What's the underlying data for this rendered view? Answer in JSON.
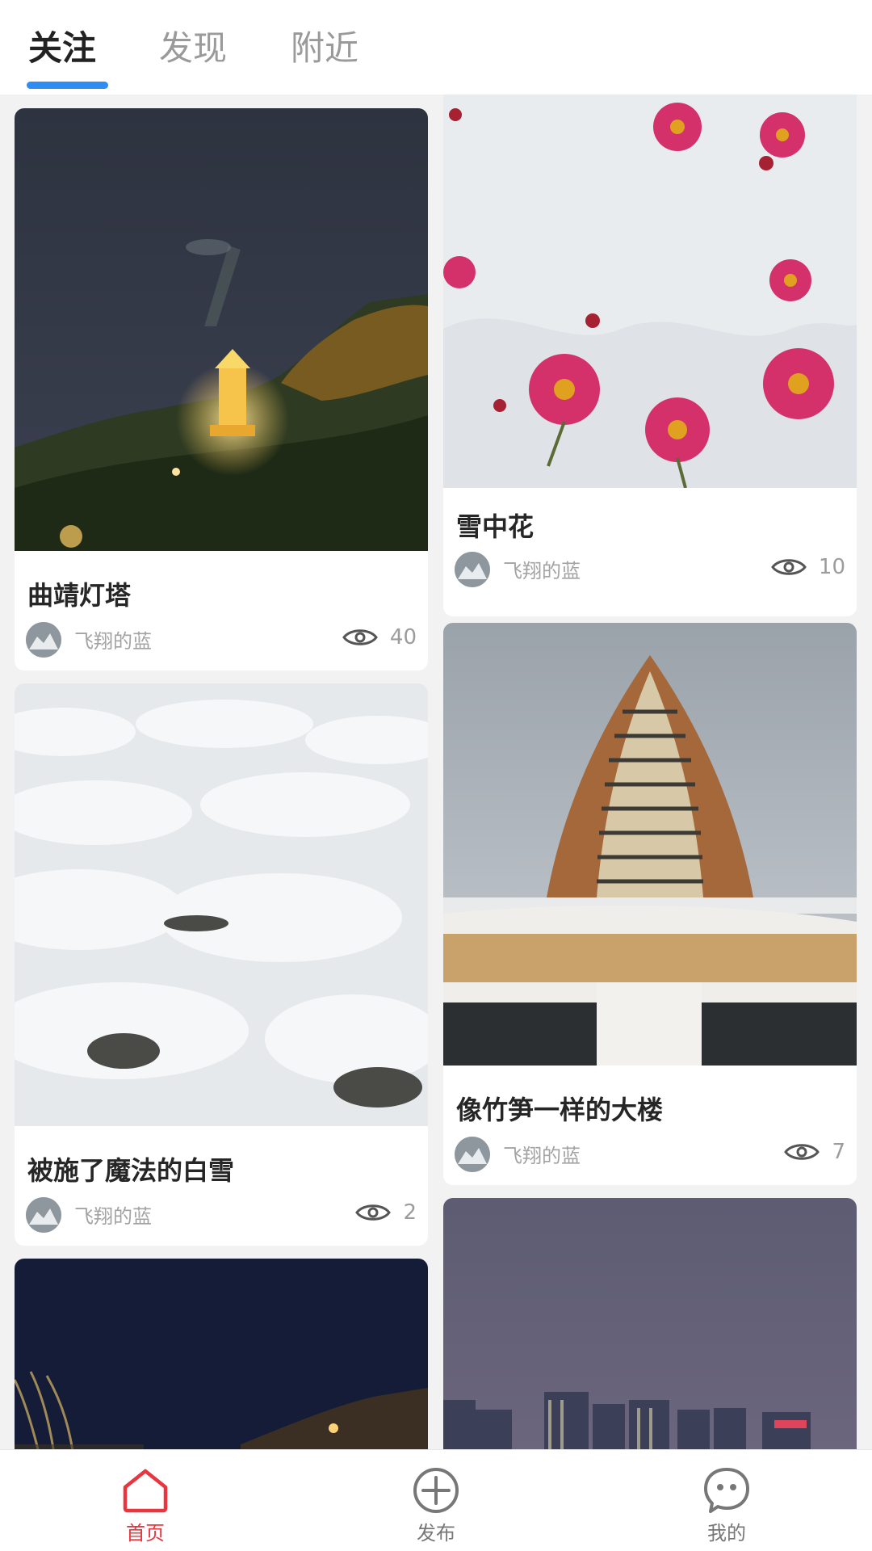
{
  "tabs": [
    {
      "label": "关注",
      "active": true
    },
    {
      "label": "发现",
      "active": false
    },
    {
      "label": "附近",
      "active": false
    }
  ],
  "posts": [
    {
      "title": "曲靖灯塔",
      "author": "飞翔的蓝",
      "views": "40",
      "image": "lighthouse-night"
    },
    {
      "title": "雪中花",
      "author": "飞翔的蓝",
      "views": "10",
      "image": "pink-flowers-in-snow"
    },
    {
      "title": "被施了魔法的白雪",
      "author": "飞翔的蓝",
      "views": "2",
      "image": "snow-covered-ground"
    },
    {
      "title": "像竹笋一样的大楼",
      "author": "飞翔的蓝",
      "views": "7",
      "image": "bamboo-shoot-building"
    },
    {
      "image": "night-lake-lighthouse"
    },
    {
      "image": "city-skyline-dusk"
    }
  ],
  "bottom_nav": [
    {
      "label": "首页",
      "icon": "home-icon",
      "active": true
    },
    {
      "label": "发布",
      "icon": "plus-circle-icon",
      "active": false
    },
    {
      "label": "我的",
      "icon": "smiley-chat-icon",
      "active": false
    }
  ],
  "colors": {
    "accent_blue": "#2d8df0",
    "active_red": "#e9363e",
    "background": "#f2f2f2"
  }
}
